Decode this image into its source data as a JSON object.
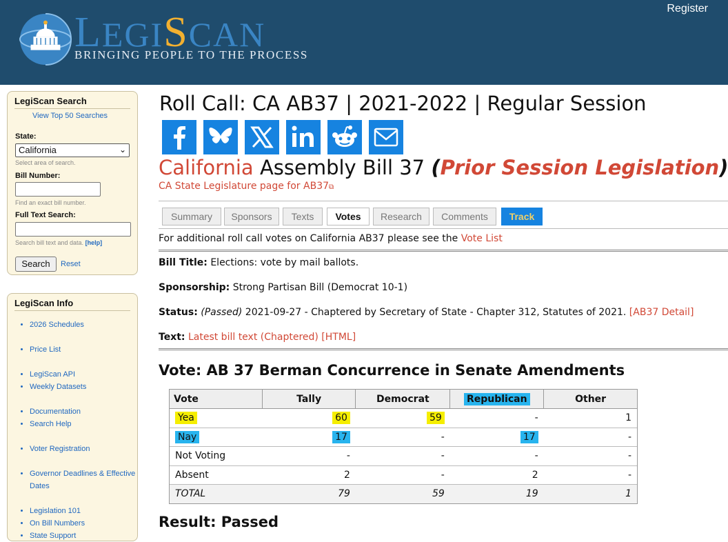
{
  "header": {
    "register_label": "Register",
    "logo": {
      "part1": "L",
      "part2": "EGI",
      "part3": "S",
      "part4": "CAN"
    },
    "tagline": "BRINGING PEOPLE TO THE PROCESS"
  },
  "sidebar": {
    "search": {
      "title": "LegiScan Search",
      "top_searches_link": "View Top 50 Searches",
      "state_label": "State:",
      "state_value": "California",
      "state_hint": "Select area of search.",
      "bill_number_label": "Bill Number:",
      "bill_number_hint": "Find an exact bill number.",
      "full_text_label": "Full Text Search:",
      "full_text_hint": "Search bill text and data.",
      "help_link": "[help]",
      "search_button": "Search",
      "reset_link": "Reset"
    },
    "info": {
      "title": "LegiScan Info",
      "items": [
        {
          "label": "2026 Schedules",
          "gap": false
        },
        {
          "label": "Price List",
          "gap": true
        },
        {
          "label": "LegiScan API",
          "gap": true
        },
        {
          "label": "Weekly Datasets",
          "gap": false
        },
        {
          "label": "Documentation",
          "gap": true
        },
        {
          "label": "Search Help",
          "gap": false
        },
        {
          "label": "Voter Registration",
          "gap": true
        },
        {
          "label": "Governor Deadlines & Effective Dates",
          "gap": true
        },
        {
          "label": "Legislation 101",
          "gap": true
        },
        {
          "label": "On Bill Numbers",
          "gap": false
        },
        {
          "label": "State Support",
          "gap": false
        }
      ]
    }
  },
  "main": {
    "title": "Roll Call: CA AB37 | 2021-2022 | Regular Session",
    "share_icons": [
      "facebook-icon",
      "bluesky-icon",
      "x-icon",
      "linkedin-icon",
      "reddit-icon",
      "email-icon"
    ],
    "bill_heading": {
      "state": "California",
      "bill": "Assembly Bill 37",
      "open_paren": "(",
      "status": "Prior Session Legislation",
      "close_paren": ")"
    },
    "state_link": "CA State Legislature page for AB37",
    "tabs": [
      "Summary",
      "Sponsors",
      "Texts",
      "Votes",
      "Research",
      "Comments",
      "Track"
    ],
    "active_tab": "Votes",
    "vote_note_prefix": "For additional roll call votes on California AB37 please see the ",
    "vote_note_link": "Vote List",
    "bill_title_label": "Bill Title:",
    "bill_title": "Elections: vote by mail ballots.",
    "sponsorship_label": "Sponsorship:",
    "sponsorship": "Strong Partisan Bill (Democrat 10-1)",
    "status_label": "Status:",
    "status_passed": "(Passed)",
    "status_text": "2021-09-27 - Chaptered by Secretary of State - Chapter 312, Statutes of 2021.",
    "status_link": "[AB37 Detail]",
    "text_label": "Text:",
    "text_link": "Latest bill text (Chaptered) [HTML]",
    "vote_heading": "Vote: AB 37 Berman Concurrence in Senate Amendments",
    "result": "Result: Passed"
  },
  "vote_table": {
    "headers": [
      "Vote",
      "Tally",
      "Democrat",
      "Republican",
      "Other"
    ],
    "rows": [
      [
        "Yea",
        "60",
        "59",
        "-",
        "1"
      ],
      [
        "Nay",
        "17",
        "-",
        "17",
        "-"
      ],
      [
        "Not Voting",
        "-",
        "-",
        "-",
        "-"
      ],
      [
        "Absent",
        "2",
        "-",
        "2",
        "-"
      ],
      [
        "TOTAL",
        "79",
        "59",
        "19",
        "1"
      ]
    ]
  },
  "colors": {
    "header_bg": "#1f4c6d",
    "link": "#d14836",
    "share_blue": "#1683e0",
    "highlight_yellow": "#f5ee00",
    "highlight_blue": "#28b4ee"
  }
}
